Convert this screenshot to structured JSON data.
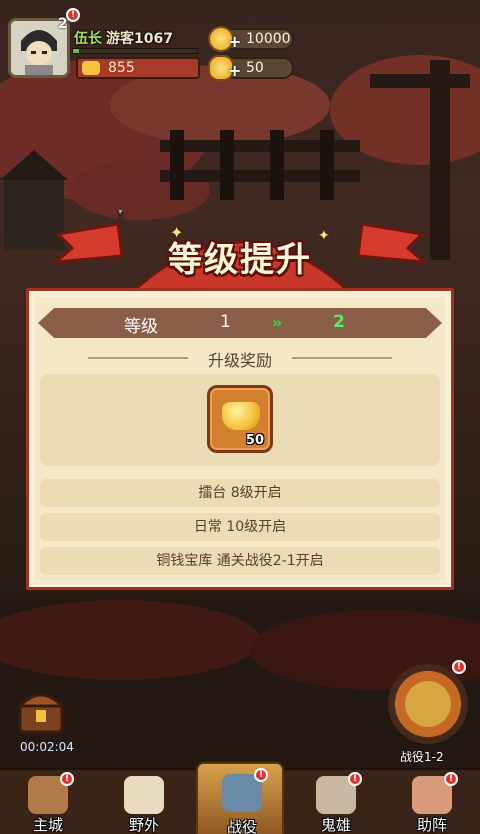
{
  "player": {
    "level": "2",
    "rank": "伍长",
    "name": "游客1067",
    "xp_progress": 0.05,
    "power": "855",
    "avatar_icon": "samurai-avatar-icon"
  },
  "resources": [
    {
      "icon": "gold-coin-icon",
      "value": "10000"
    },
    {
      "icon": "gold-ingot-icon",
      "value": "50"
    }
  ],
  "dialog": {
    "title": "等级提升",
    "level_label": "等级",
    "from_level": "1",
    "to_level": "2",
    "arrow_icon": "double-chevron-right-icon",
    "reward_title": "升级奖励",
    "reward": {
      "icon": "gold-ingot-icon",
      "quantity": "50"
    },
    "unlocks": [
      "擂台 8级开启",
      "日常 10级开启",
      "铜钱宝库 通关战役2-1开启"
    ]
  },
  "side": {
    "chest_timer": "00:02:04",
    "campaign_label": "战役1-2"
  },
  "nav": [
    {
      "label": "主城",
      "icon": "castle-icon",
      "badge": true
    },
    {
      "label": "野外",
      "icon": "flag-icon",
      "badge": false
    },
    {
      "label": "战役",
      "icon": "crossed-swords-icon",
      "badge": true,
      "active": true
    },
    {
      "label": "鬼雄",
      "icon": "skull-helmet-icon",
      "badge": true
    },
    {
      "label": "助阵",
      "icon": "scroll-icon",
      "badge": true
    }
  ],
  "colors": {
    "accent_red": "#c8372a",
    "panel_bg": "#f9efd6",
    "ribbon": "#8b5e4a",
    "level_up_green": "#4ff05a",
    "badge_red": "#e2322a"
  }
}
